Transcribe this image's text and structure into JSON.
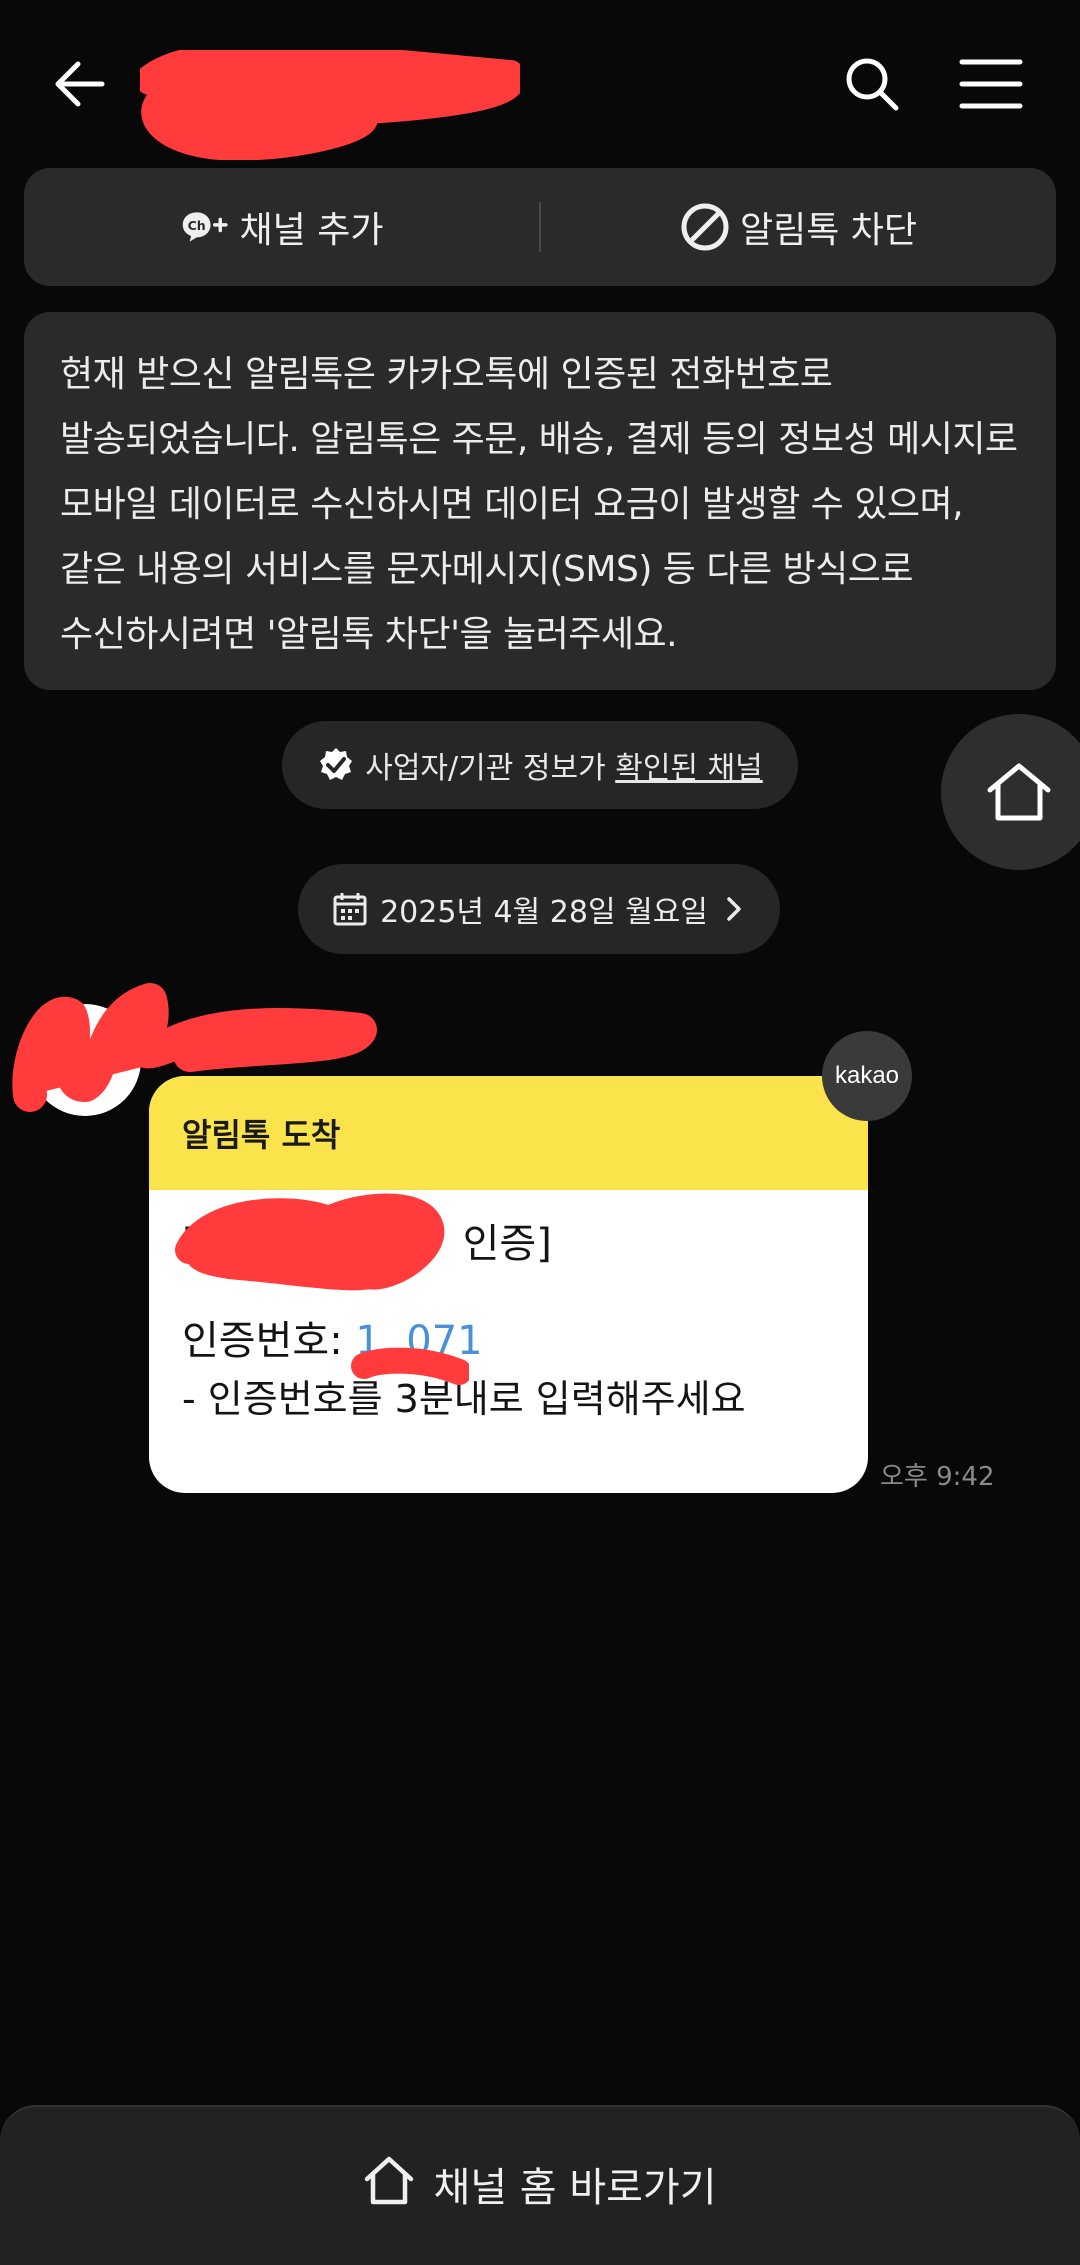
{
  "header": {
    "back_icon": "arrow-left-icon",
    "search_icon": "search-icon",
    "menu_icon": "hamburger-menu-icon"
  },
  "actions": {
    "add_channel": {
      "label": "채널 추가",
      "icon": "channel-plus-icon"
    },
    "block_alimtalk": {
      "label": "알림톡 차단",
      "icon": "block-icon"
    }
  },
  "notice": {
    "text": "현재 받으신 알림톡은 카카오톡에 인증된 전화번호로 발송되었습니다. 알림톡은 주문, 배송, 결제 등의 정보성 메시지로 모바일 데이터로 수신하시면 데이터 요금이 발생할 수 있으며, 같은 내용의 서비스를 문자메시지(SMS) 등 다른 방식으로 수신하시려면 '알림톡 차단'을 눌러주세요."
  },
  "verified": {
    "prefix": "사업자/기관 정보가 ",
    "link": "확인된 채널",
    "icon": "verified-check-icon"
  },
  "date_divider": {
    "label": "2025년 4월 28일 월요일",
    "icon": "calendar-icon"
  },
  "message": {
    "header": "알림톡 도착",
    "line1_open": "[",
    "line1_close": "인증]",
    "code_label": "인증번호: ",
    "code_visible": "1  071",
    "instruction": "- 인증번호를 3분내로 입력해주세요",
    "badge": "kakao",
    "time": "오후 9:42"
  },
  "bottom": {
    "label": "채널 홈 바로가기",
    "icon": "home-icon"
  },
  "colors": {
    "background": "#080808",
    "panel": "#2a2a2a",
    "card_header": "#fbe44b",
    "link_code": "#4a90d9",
    "redaction": "#ff3b3b"
  }
}
